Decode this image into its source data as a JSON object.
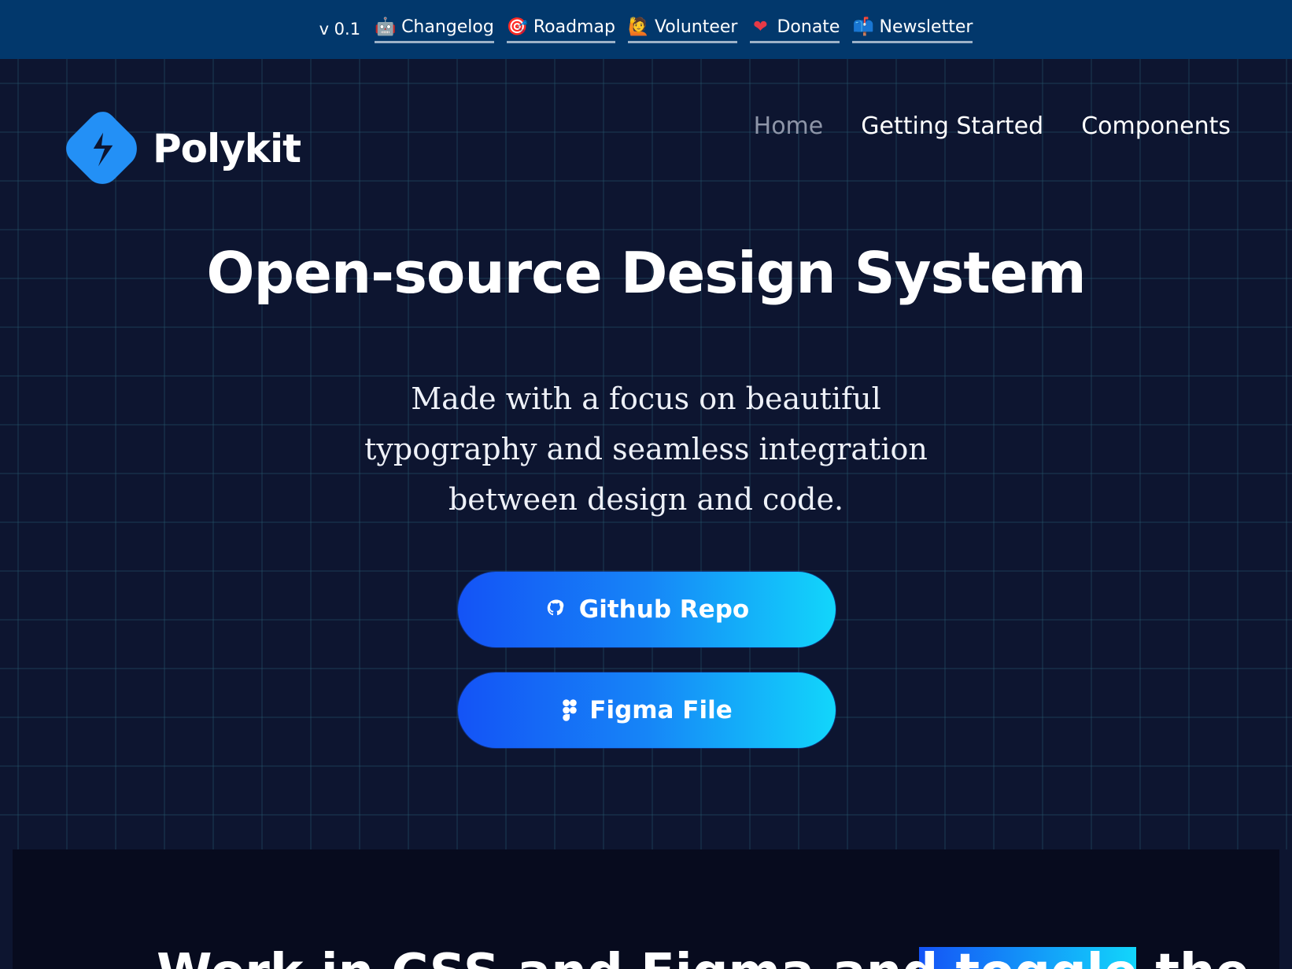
{
  "topbar": {
    "version": "v 0.1",
    "links": [
      {
        "label": "Changelog",
        "icon": "robot-icon",
        "glyph": "🤖"
      },
      {
        "label": "Roadmap",
        "icon": "target-icon",
        "glyph": "🎯"
      },
      {
        "label": "Volunteer",
        "icon": "raising-hand-icon",
        "glyph": "🙋"
      },
      {
        "label": "Donate",
        "icon": "heart-icon",
        "glyph": "❤"
      },
      {
        "label": "Newsletter",
        "icon": "mailbox-icon",
        "glyph": "📫"
      }
    ]
  },
  "logo": {
    "text": "Polykit",
    "color": "#2390f6"
  },
  "nav": {
    "items": [
      {
        "label": "Home",
        "active": true
      },
      {
        "label": "Getting Started",
        "active": false
      },
      {
        "label": "Components",
        "active": false
      }
    ]
  },
  "hero": {
    "headline": "Open-source Design System",
    "subtitle_lines": [
      "Made with a focus on beautiful",
      "typography and seamless integration",
      "between design and code."
    ],
    "buttons": {
      "github": {
        "label": "Github Repo",
        "icon": "github-icon"
      },
      "figma": {
        "label": "Figma File",
        "icon": "figma-icon"
      }
    }
  },
  "lower": {
    "title_partial": "Work in CSS and Figma and toggle the"
  },
  "colors": {
    "topbar_bg": "#02386c",
    "page_bg": "#0d1530",
    "button_gradient_start": "#1453f6",
    "button_gradient_end": "#12d6fb"
  }
}
